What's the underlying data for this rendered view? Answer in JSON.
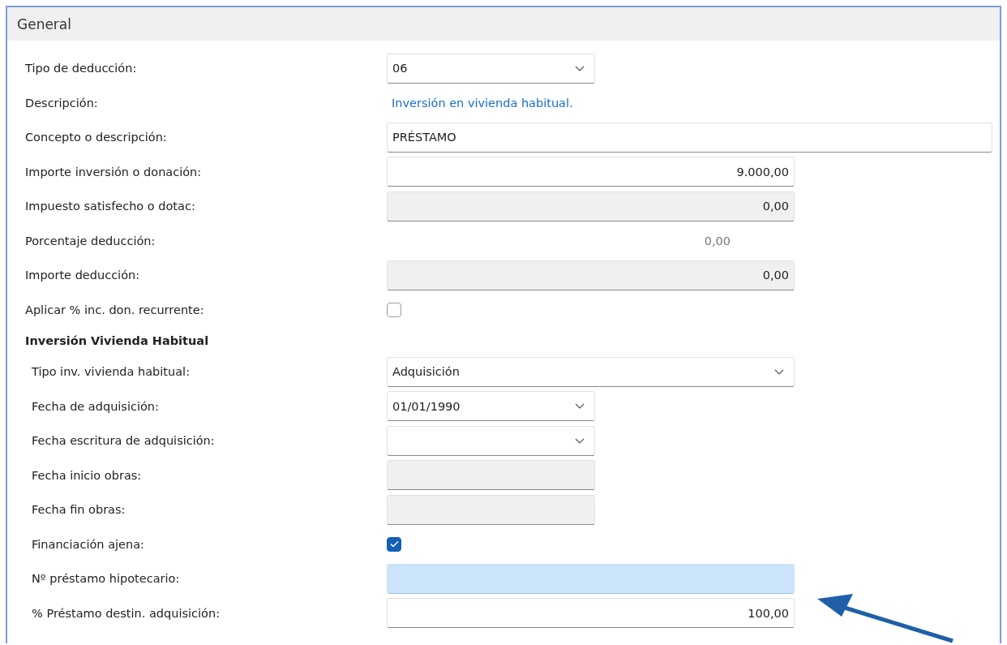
{
  "panel": {
    "title": "General"
  },
  "fields": [
    {
      "label": "Tipo de deducción:",
      "kind": "code-select",
      "value": "06"
    },
    {
      "label": "Descripción:",
      "kind": "link",
      "value": "Inversión en vivienda habitual."
    },
    {
      "label": "Concepto o descripción:",
      "kind": "text",
      "value": "PRÉSTAMO"
    },
    {
      "label": "Importe inversión o donación:",
      "kind": "amount",
      "value": "9.000,00",
      "disabled": false
    },
    {
      "label": "Impuesto satisfecho o dotac:",
      "kind": "amount",
      "value": "0,00",
      "disabled": true
    },
    {
      "label": "Porcentaje deducción:",
      "kind": "plain",
      "value": "0,00"
    },
    {
      "label": "Importe deducción:",
      "kind": "amount",
      "value": "0,00",
      "disabled": true
    },
    {
      "label": "Aplicar % inc. don. recurrente:",
      "kind": "checkbox",
      "checked": false
    }
  ],
  "section": {
    "title": "Inversión Vivienda Habitual",
    "fields": [
      {
        "label": "Tipo inv. vivienda habitual:",
        "kind": "select",
        "value": "Adquisición"
      },
      {
        "label": "Fecha de adquisición:",
        "kind": "date-select",
        "value": "01/01/1990"
      },
      {
        "label": "Fecha escritura de adquisición:",
        "kind": "date-select"
      },
      {
        "label": "Fecha inicio obras:",
        "kind": "date-field",
        "disabled": true
      },
      {
        "label": "Fecha fin obras:",
        "kind": "date-field",
        "disabled": true
      },
      {
        "label": "Financiación ajena:",
        "kind": "checkbox",
        "checked": true
      },
      {
        "label": "Nº préstamo hipotecario:",
        "kind": "amount",
        "disabled": false,
        "focused": true
      },
      {
        "label": "% Préstamo destin. adquisición:",
        "kind": "amount",
        "value": "100,00",
        "disabled": false
      }
    ]
  }
}
